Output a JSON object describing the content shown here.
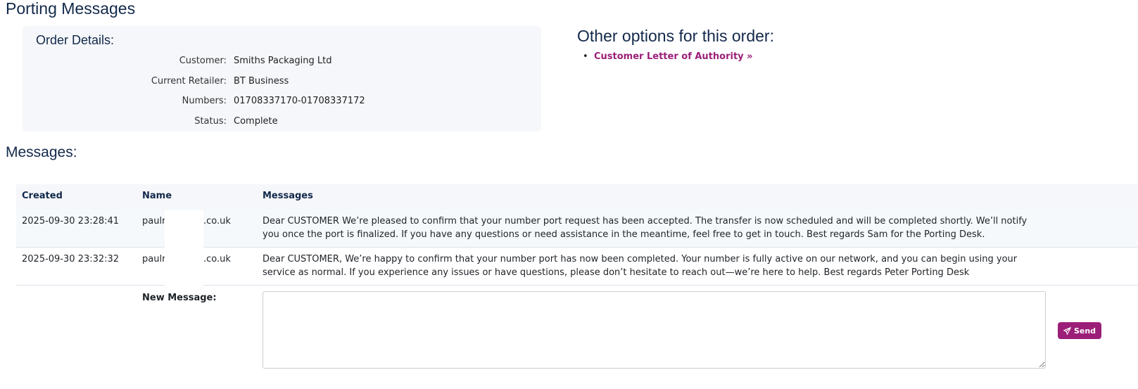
{
  "page": {
    "title": "Porting Messages"
  },
  "order_details": {
    "heading": "Order Details:",
    "rows": [
      {
        "label": "Customer:",
        "value": "Smiths Packaging Ltd"
      },
      {
        "label": "Current Retailer:",
        "value": "BT Business"
      },
      {
        "label": "Numbers:",
        "value": "01708337170-01708337172"
      },
      {
        "label": "Status:",
        "value": "Complete"
      }
    ]
  },
  "other_options": {
    "heading": "Other options for this order:",
    "bullet": "•",
    "links": [
      {
        "label": "Customer Letter of Authority »"
      }
    ]
  },
  "messages": {
    "heading": "Messages:",
    "columns": {
      "created": "Created",
      "name": "Name",
      "messages": "Messages"
    },
    "rows": [
      {
        "created": "2025-09-30 23:28:41",
        "name_start": "paulr",
        "name_end": ".co.uk",
        "text": "Dear CUSTOMER We’re pleased to confirm that your number port request has been accepted. The transfer is now scheduled and will be completed shortly. We’ll notify you once the port is finalized. If you have any questions or need assistance in the meantime, feel free to get in touch. Best regards Sam for the Porting Desk."
      },
      {
        "created": "2025-09-30 23:32:32",
        "name_start": "paulr",
        "name_end": ".co.uk",
        "text": "Dear CUSTOMER, We’re happy to confirm that your number port has now been completed. Your number is fully active on our network, and you can begin using your service as normal. If you experience any issues or have questions, please don’t hesitate to reach out—we’re here to help. Best regards Peter Porting Desk"
      }
    ],
    "new_message_label": "New Message:",
    "new_message_value": "",
    "send_label": "Send",
    "send_icon": "paper-plane-icon"
  },
  "colors": {
    "heading": "#13294b",
    "accent": "#9b1f78",
    "panel_bg": "#f5f7fa",
    "alt_row_bg": "#f5f9fc"
  }
}
